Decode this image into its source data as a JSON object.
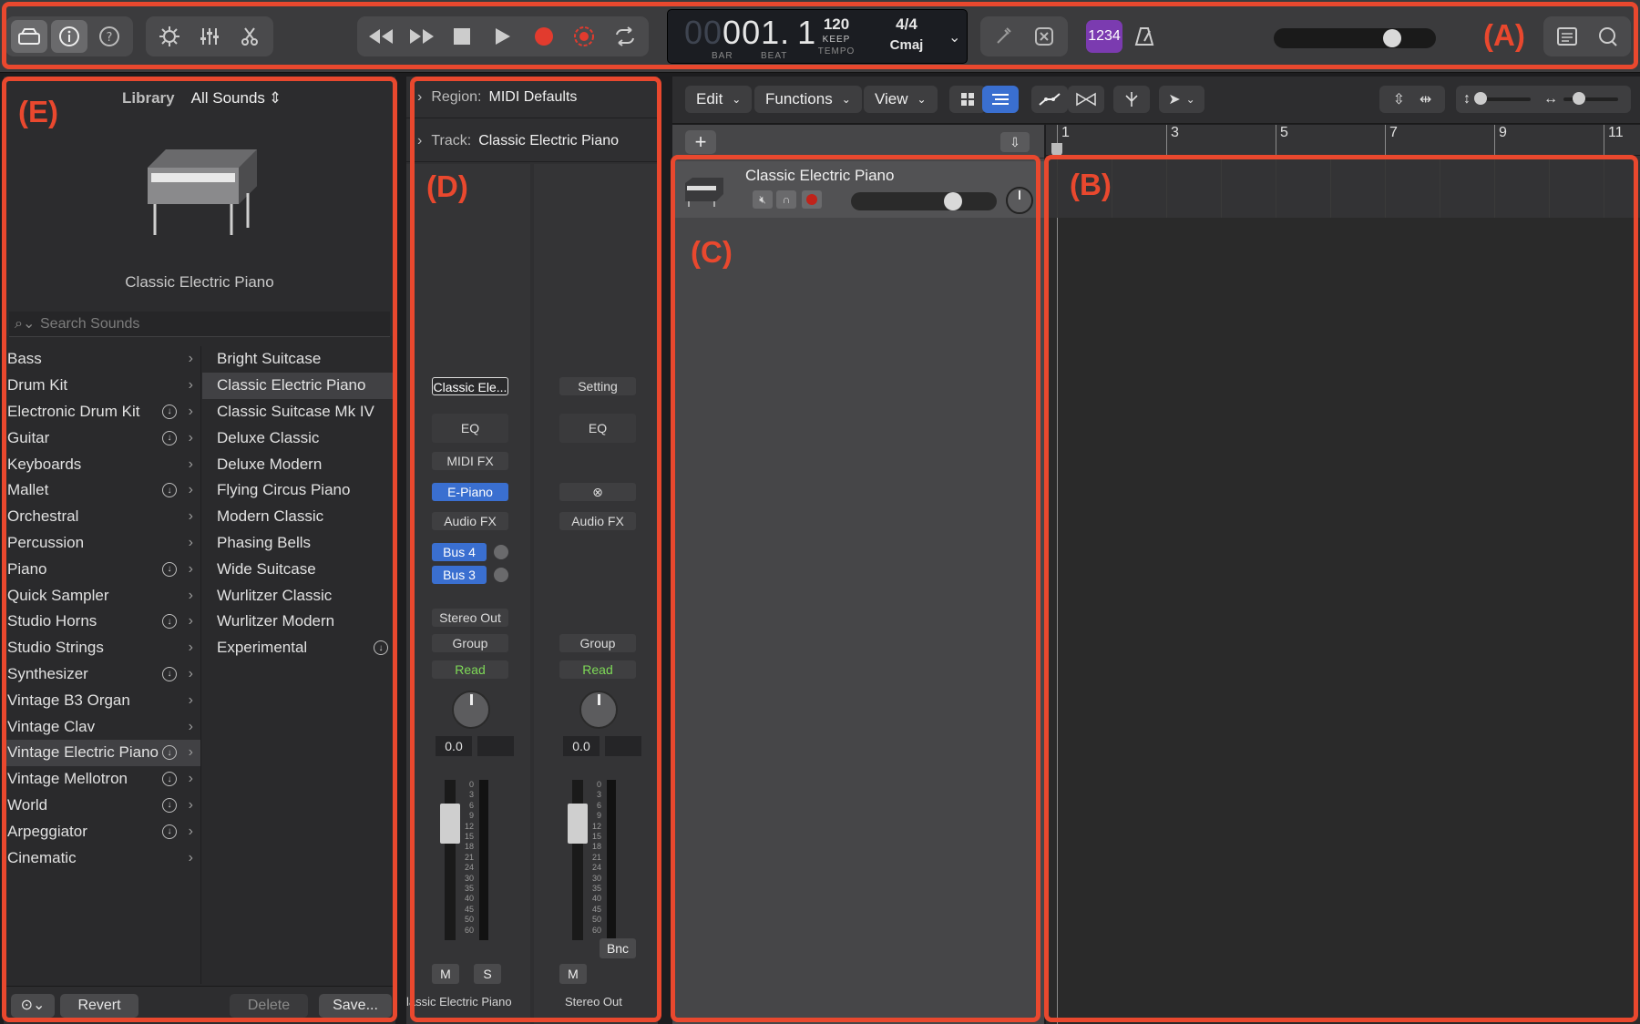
{
  "callouts": {
    "a": "(A)",
    "b": "(B)",
    "c": "(C)",
    "d": "(D)",
    "e": "(E)"
  },
  "colors": {
    "accent": "#e9482e",
    "blue_slot": "#3a6fd0",
    "read_green": "#7ed957",
    "count_in": "#7b3bb0"
  },
  "lcd": {
    "bar_digits": "001.",
    "beat_digits": "1",
    "bar_label": "BAR",
    "beat_label": "BEAT",
    "tempo": "120",
    "tempo_mode": "KEEP",
    "tempo_label": "TEMPO",
    "signature": "4/4",
    "key": "Cmaj"
  },
  "control": {
    "count_in": "1234"
  },
  "library": {
    "title": "Library",
    "scope": "All Sounds",
    "patch_name": "Classic Electric Piano",
    "search_placeholder": "Search Sounds",
    "categories": [
      {
        "label": "Bass",
        "dl": false
      },
      {
        "label": "Drum Kit",
        "dl": false
      },
      {
        "label": "Electronic Drum Kit",
        "dl": true
      },
      {
        "label": "Guitar",
        "dl": true
      },
      {
        "label": "Keyboards",
        "dl": false
      },
      {
        "label": "Mallet",
        "dl": true
      },
      {
        "label": "Orchestral",
        "dl": false
      },
      {
        "label": "Percussion",
        "dl": false
      },
      {
        "label": "Piano",
        "dl": true
      },
      {
        "label": "Quick Sampler",
        "dl": false
      },
      {
        "label": "Studio Horns",
        "dl": true
      },
      {
        "label": "Studio Strings",
        "dl": false
      },
      {
        "label": "Synthesizer",
        "dl": true
      },
      {
        "label": "Vintage B3 Organ",
        "dl": false
      },
      {
        "label": "Vintage Clav",
        "dl": false
      },
      {
        "label": "Vintage Electric Piano",
        "dl": true
      },
      {
        "label": "Vintage Mellotron",
        "dl": true
      },
      {
        "label": "World",
        "dl": true
      },
      {
        "label": "Arpeggiator",
        "dl": true
      },
      {
        "label": "Cinematic",
        "dl": false
      }
    ],
    "patches": [
      {
        "label": "Bright Suitcase",
        "dl": false
      },
      {
        "label": "Classic Electric Piano",
        "dl": false
      },
      {
        "label": "Classic Suitcase Mk IV",
        "dl": false
      },
      {
        "label": "Deluxe Classic",
        "dl": false
      },
      {
        "label": "Deluxe Modern",
        "dl": false
      },
      {
        "label": "Flying Circus Piano",
        "dl": false
      },
      {
        "label": "Modern Classic",
        "dl": false
      },
      {
        "label": "Phasing Bells",
        "dl": false
      },
      {
        "label": "Wide Suitcase",
        "dl": false
      },
      {
        "label": "Wurlitzer Classic",
        "dl": false
      },
      {
        "label": "Wurlitzer Modern",
        "dl": false
      },
      {
        "label": "Experimental",
        "dl": true
      }
    ],
    "footer": {
      "revert": "Revert",
      "delete": "Delete",
      "save": "Save..."
    }
  },
  "inspector": {
    "region_label": "Region:",
    "region_value": "MIDI Defaults",
    "track_label": "Track:",
    "track_value": "Classic Electric Piano",
    "strip1": {
      "setting": "Classic Ele...",
      "eq": "EQ",
      "midi_fx": "MIDI FX",
      "instrument": "E-Piano",
      "audio_fx": "Audio FX",
      "bus_a": "Bus 4",
      "bus_b": "Bus 3",
      "output": "Stereo Out",
      "group": "Group",
      "automation": "Read",
      "volume": "0.0",
      "mute": "M",
      "solo": "S",
      "name": "lassic Electric Piano"
    },
    "strip2": {
      "setting": "Setting",
      "eq": "EQ",
      "audio_fx": "Audio FX",
      "group": "Group",
      "automation": "Read",
      "volume": "0.0",
      "bounce": "Bnc",
      "mute": "M",
      "name": "Stereo Out"
    },
    "fader_scale": [
      "0",
      "3",
      "6",
      "9",
      "12",
      "15",
      "18",
      "21",
      "24",
      "30",
      "35",
      "40",
      "45",
      "50",
      "60"
    ]
  },
  "tracks": {
    "menus": {
      "edit": "Edit",
      "functions": "Functions",
      "view": "View"
    },
    "track_name": "Classic Electric Piano",
    "add": "+"
  },
  "ruler": [
    "1",
    "3",
    "5",
    "7",
    "9",
    "11"
  ]
}
